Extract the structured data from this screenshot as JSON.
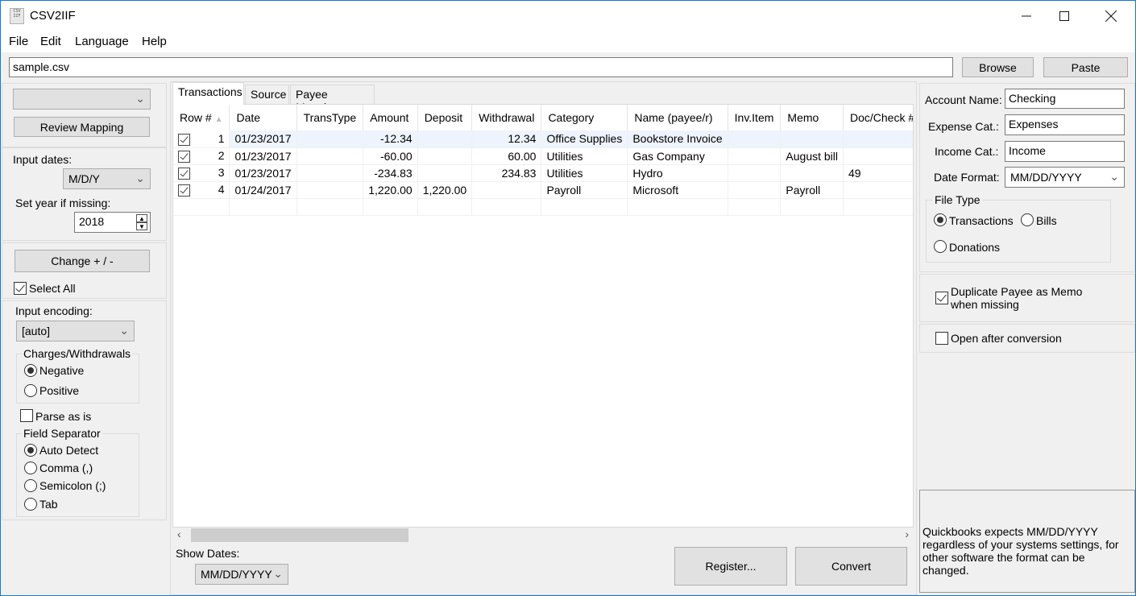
{
  "window": {
    "title": "CSV2IIF",
    "app_icon_text": "CSV IIF",
    "controls": {
      "minimize": "—",
      "maximize": "☐",
      "close": "✕"
    }
  },
  "menu": {
    "items": [
      "File",
      "Edit",
      "Language",
      "Help"
    ]
  },
  "file_bar": {
    "path_value": "sample.csv",
    "browse_label": "Browse",
    "paste_label": "Paste"
  },
  "left_panel": {
    "mapping_combo_value": "",
    "review_mapping_label": "Review Mapping",
    "input_dates_label": "Input dates:",
    "input_dates_value": "M/D/Y",
    "set_year_label": "Set year if missing:",
    "year_value": "2018",
    "change_sign_label": "Change + / -",
    "select_all_label": "Select All",
    "select_all_checked": true,
    "input_encoding_label": "Input encoding:",
    "input_encoding_value": "[auto]",
    "charges_group": {
      "title": "Charges/Withdrawals",
      "options": [
        "Negative",
        "Positive"
      ],
      "selected": "Negative"
    },
    "parse_as_is_label": "Parse as is",
    "parse_as_is_checked": false,
    "separator_group": {
      "title": "Field Separator",
      "options": [
        "Auto Detect",
        "Comma (,)",
        "Semicolon (;)",
        "Tab"
      ],
      "selected": "Auto Detect"
    }
  },
  "tabs": [
    {
      "label": "Transactions",
      "active": true
    },
    {
      "label": "Source",
      "active": false
    },
    {
      "label": "Payee Mapping",
      "active": false
    }
  ],
  "table": {
    "columns": [
      "Row #",
      "Date",
      "TransType",
      "Amount",
      "Deposit",
      "Withdrawal",
      "Category",
      "Name (payee/r)",
      "Inv.Item",
      "Memo",
      "Doc/Check #"
    ],
    "sort_indicator": "▲",
    "rows": [
      {
        "checked": true,
        "row": "1",
        "date": "01/23/2017",
        "transtype": "",
        "amount": "-12.34",
        "deposit": "",
        "withdrawal": "12.34",
        "category": "Office Supplies",
        "name": "Bookstore Invoice",
        "invitem": "",
        "memo": "",
        "doc": ""
      },
      {
        "checked": true,
        "row": "2",
        "date": "01/23/2017",
        "transtype": "",
        "amount": "-60.00",
        "deposit": "",
        "withdrawal": "60.00",
        "category": "Utilities",
        "name": "Gas Company",
        "invitem": "",
        "memo": "August bill",
        "doc": ""
      },
      {
        "checked": true,
        "row": "3",
        "date": "01/23/2017",
        "transtype": "",
        "amount": "-234.83",
        "deposit": "",
        "withdrawal": "234.83",
        "category": "Utilities",
        "name": "Hydro",
        "invitem": "",
        "memo": "",
        "doc": "49"
      },
      {
        "checked": true,
        "row": "4",
        "date": "01/24/2017",
        "transtype": "",
        "amount": "1,220.00",
        "deposit": "1,220.00",
        "withdrawal": "",
        "category": "Payroll",
        "name": "Microsoft",
        "invitem": "",
        "memo": "Payroll",
        "doc": ""
      }
    ]
  },
  "bottom": {
    "show_dates_label": "Show Dates:",
    "show_dates_value": "MM/DD/YYYY",
    "register_label": "Register...",
    "convert_label": "Convert"
  },
  "right_panel": {
    "account_name_label": "Account Name:",
    "account_name_value": "Checking",
    "expense_cat_label": "Expense Cat.:",
    "expense_cat_value": "Expenses",
    "income_cat_label": "Income Cat.:",
    "income_cat_value": "Income",
    "date_format_label": "Date Format:",
    "date_format_value": "MM/DD/YYYY",
    "file_type_group": {
      "title": "File Type",
      "options": [
        "Transactions",
        "Bills",
        "Donations"
      ],
      "selected": "Transactions"
    },
    "duplicate_payee_label": "Duplicate Payee as Memo when missing",
    "duplicate_payee_checked": true,
    "open_after_label": "Open after conversion",
    "open_after_checked": false,
    "info_text": "Quickbooks expects MM/DD/YYYY regardless of your systems settings, for other software the format can be changed."
  }
}
